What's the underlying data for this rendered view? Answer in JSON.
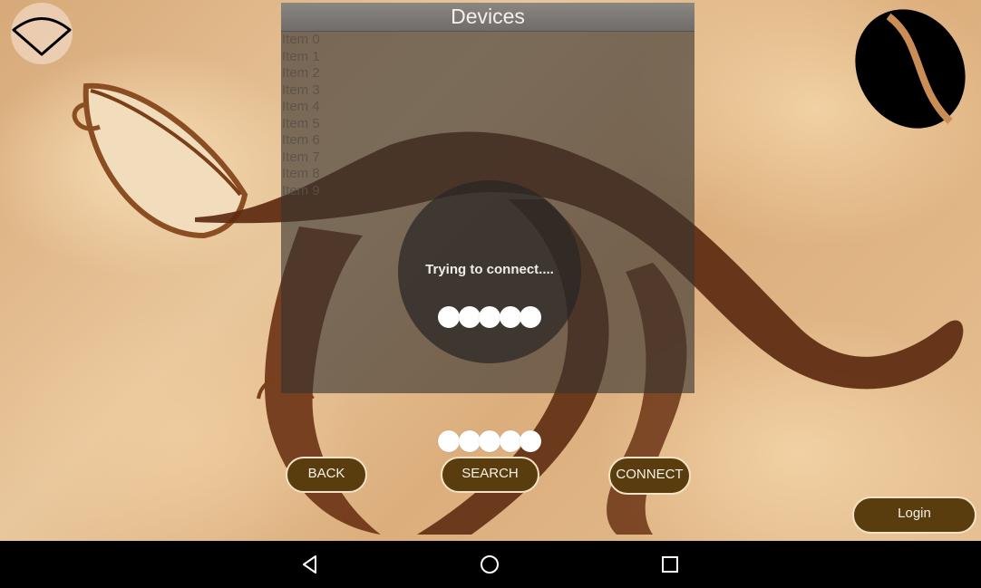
{
  "dialog": {
    "title": "Devices",
    "items": [
      "Item 0",
      "Item 1",
      "Item 2",
      "Item 3",
      "Item 4",
      "Item 5",
      "Item 6",
      "Item 7",
      "Item 8",
      "Item 9"
    ]
  },
  "progress": {
    "message": "Trying to connect...."
  },
  "buttons": {
    "back": "BACK",
    "search": "SEARCH",
    "connect": "CONNECT",
    "login": "Login"
  },
  "icons": {
    "wifi": "wifi-icon",
    "bean": "coffee-bean-icon",
    "back": "nav-back-icon",
    "home": "nav-home-icon",
    "recents": "nav-recents-icon"
  },
  "colors": {
    "button_fill": "#5a3d0e",
    "button_border": "#f3e3c4",
    "dialog_title_bg": "#7d7a76"
  }
}
